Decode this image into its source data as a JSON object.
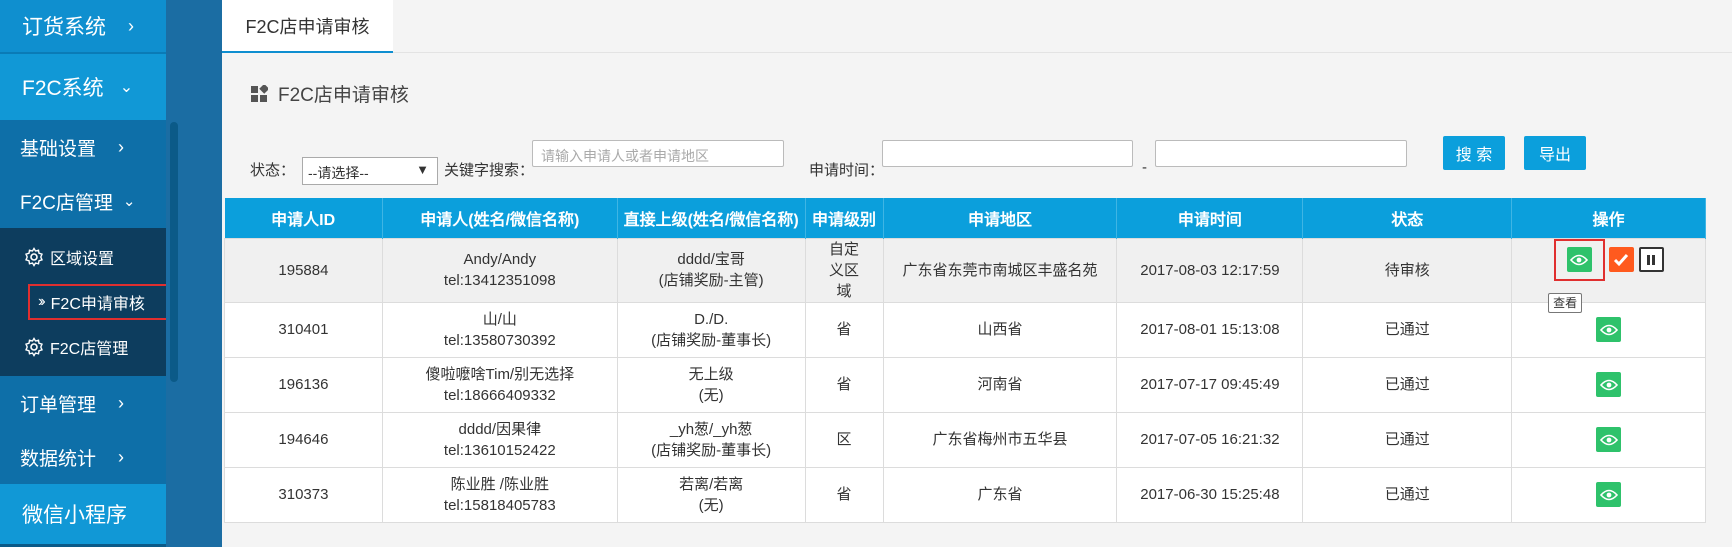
{
  "sidebar": {
    "top_item": "订货系统",
    "f2c_system": "F2C系统",
    "items": [
      {
        "label": "基础设置"
      },
      {
        "label": "F2C店管理"
      }
    ],
    "sub_items": [
      {
        "label": "区域设置"
      },
      {
        "label": "F2C申请审核"
      },
      {
        "label": "F2C店管理"
      }
    ],
    "more_items": [
      {
        "label": "订单管理"
      },
      {
        "label": "数据统计"
      }
    ],
    "bottom_item": "微信小程序"
  },
  "tab": {
    "label": "F2C店申请审核"
  },
  "panel": {
    "title": "F2C店申请审核"
  },
  "filters": {
    "status_label": "状态：",
    "status_value": "--请选择--",
    "keyword_label": "关键字搜索：",
    "keyword_placeholder": "请输入申请人或者申请地区",
    "time_label": "申请时间：",
    "time_sep": "-",
    "search_button": "搜 索",
    "export_button": "导出"
  },
  "table": {
    "headers": [
      "申请人ID",
      "申请人(姓名/微信名称)",
      "直接上级(姓名/微信名称)",
      "申请级别",
      "申请地区",
      "申请时间",
      "状态",
      "操作"
    ],
    "rows": [
      {
        "id": "195884",
        "applicant": "Andy/Andy",
        "applicant_tel": "tel:13412351098",
        "superior": "dddd/宝哥",
        "superior_note": "(店铺奖励-主管)",
        "level": "自定义区域",
        "region": "广东省东莞市南城区丰盛名苑",
        "time": "2017-08-03 12:17:59",
        "status": "待审核"
      },
      {
        "id": "310401",
        "applicant": "山/山",
        "applicant_tel": "tel:13580730392",
        "superior": "D./D.",
        "superior_note": "(店铺奖励-董事长)",
        "level": "省",
        "region": "山西省",
        "time": "2017-08-01 15:13:08",
        "status": "已通过"
      },
      {
        "id": "196136",
        "applicant": "傻啦嚒啥Tim/别无选择",
        "applicant_tel": "tel:18666409332",
        "superior": "无上级",
        "superior_note": "(无)",
        "level": "省",
        "region": "河南省",
        "time": "2017-07-17 09:45:49",
        "status": "已通过"
      },
      {
        "id": "194646",
        "applicant": "dddd/因果律",
        "applicant_tel": "tel:13610152422",
        "superior": "_yh葱/_yh葱",
        "superior_note": "(店铺奖励-董事长)",
        "level": "区",
        "region": "广东省梅州市五华县",
        "time": "2017-07-05 16:21:32",
        "status": "已通过"
      },
      {
        "id": "310373",
        "applicant": "陈业胜 /陈业胜",
        "applicant_tel": "tel:15818405783",
        "superior": "若离/若离",
        "superior_note": "(无)",
        "level": "省",
        "region": "广东省",
        "time": "2017-06-30 15:25:48",
        "status": "已通过"
      }
    ],
    "tooltip": "查看"
  },
  "colors": {
    "accent": "#0b9fdc",
    "sidebar_dark": "#0b5a88",
    "highlight_red": "#e02f2f",
    "view_green": "#2ec26b",
    "approve_orange": "#ff5a1e"
  }
}
